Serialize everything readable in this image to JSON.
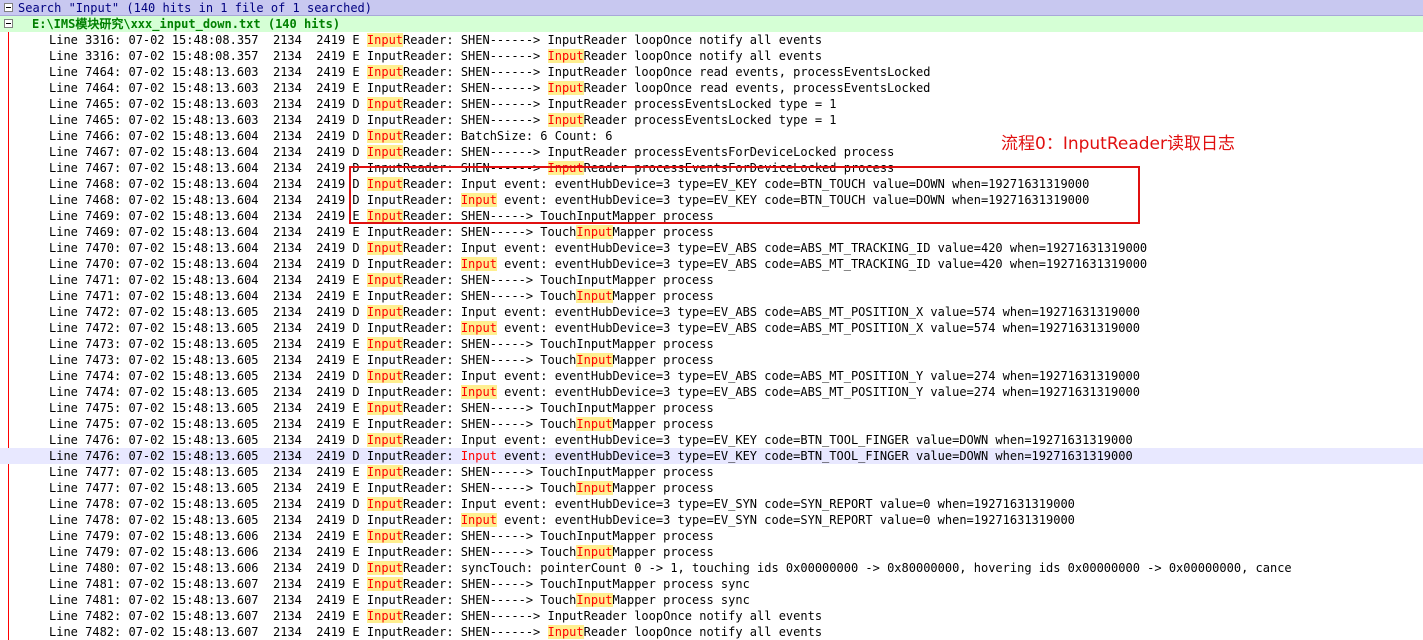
{
  "search": {
    "header": "Search \"Input\" (140 hits in 1 file of 1 searched)",
    "file_header": "E:\\IMS模块研究\\xxx_input_down.txt (140 hits)"
  },
  "annotation": {
    "label": "流程0：InputReader读取日志",
    "color": "#e01010"
  },
  "colors": {
    "search_header_bg": "#c8c8f0",
    "file_header_bg": "#d5ffd5",
    "hit_highlight_bg": "#ffef90",
    "hit_text": "#ff0000",
    "current_line_bg": "#e8e8ff"
  },
  "icons": {
    "collapse": "minus-box-icon"
  },
  "rows": [
    {
      "pre": "Line 3316: 07-02 15:48:08.357  2134  2419 E ",
      "hit": "Input",
      "post": "Reader: SHEN------> InputReader loopOnce notify all events"
    },
    {
      "pre": "Line 3316: 07-02 15:48:08.357  2134  2419 E InputReader: SHEN------> ",
      "hit": "Input",
      "post": "Reader loopOnce notify all events"
    },
    {
      "pre": "Line 7464: 07-02 15:48:13.603  2134  2419 E ",
      "hit": "Input",
      "post": "Reader: SHEN------> InputReader loopOnce read events, processEventsLocked"
    },
    {
      "pre": "Line 7464: 07-02 15:48:13.603  2134  2419 E InputReader: SHEN------> ",
      "hit": "Input",
      "post": "Reader loopOnce read events, processEventsLocked"
    },
    {
      "pre": "Line 7465: 07-02 15:48:13.603  2134  2419 D ",
      "hit": "Input",
      "post": "Reader: SHEN------> InputReader processEventsLocked type = 1"
    },
    {
      "pre": "Line 7465: 07-02 15:48:13.603  2134  2419 D InputReader: SHEN------> ",
      "hit": "Input",
      "post": "Reader processEventsLocked type = 1"
    },
    {
      "pre": "Line 7466: 07-02 15:48:13.604  2134  2419 D ",
      "hit": "Input",
      "post": "Reader: BatchSize: 6 Count: 6"
    },
    {
      "pre": "Line 7467: 07-02 15:48:13.604  2134  2419 D ",
      "hit": "Input",
      "post": "Reader: SHEN------> InputReader processEventsForDeviceLocked process"
    },
    {
      "pre": "Line 7467: 07-02 15:48:13.604  2134  2419 D InputReader: SHEN------> ",
      "hit": "Input",
      "post": "Reader processEventsForDeviceLocked process"
    },
    {
      "pre": "Line 7468: 07-02 15:48:13.604  2134  2419 D ",
      "hit": "Input",
      "post": "Reader: Input event: eventHubDevice=3 type=EV_KEY code=BTN_TOUCH value=DOWN when=19271631319000"
    },
    {
      "pre": "Line 7468: 07-02 15:48:13.604  2134  2419 D InputReader: ",
      "hit": "Input",
      "post": " event: eventHubDevice=3 type=EV_KEY code=BTN_TOUCH value=DOWN when=19271631319000"
    },
    {
      "pre": "Line 7469: 07-02 15:48:13.604  2134  2419 E ",
      "hit": "Input",
      "post": "Reader: SHEN-----> TouchInputMapper process"
    },
    {
      "pre": "Line 7469: 07-02 15:48:13.604  2134  2419 E InputReader: SHEN-----> Touch",
      "hit": "Input",
      "post": "Mapper process"
    },
    {
      "pre": "Line 7470: 07-02 15:48:13.604  2134  2419 D ",
      "hit": "Input",
      "post": "Reader: Input event: eventHubDevice=3 type=EV_ABS code=ABS_MT_TRACKING_ID value=420 when=19271631319000"
    },
    {
      "pre": "Line 7470: 07-02 15:48:13.604  2134  2419 D InputReader: ",
      "hit": "Input",
      "post": " event: eventHubDevice=3 type=EV_ABS code=ABS_MT_TRACKING_ID value=420 when=19271631319000"
    },
    {
      "pre": "Line 7471: 07-02 15:48:13.604  2134  2419 E ",
      "hit": "Input",
      "post": "Reader: SHEN-----> TouchInputMapper process"
    },
    {
      "pre": "Line 7471: 07-02 15:48:13.604  2134  2419 E InputReader: SHEN-----> Touch",
      "hit": "Input",
      "post": "Mapper process"
    },
    {
      "pre": "Line 7472: 07-02 15:48:13.605  2134  2419 D ",
      "hit": "Input",
      "post": "Reader: Input event: eventHubDevice=3 type=EV_ABS code=ABS_MT_POSITION_X value=574 when=19271631319000"
    },
    {
      "pre": "Line 7472: 07-02 15:48:13.605  2134  2419 D InputReader: ",
      "hit": "Input",
      "post": " event: eventHubDevice=3 type=EV_ABS code=ABS_MT_POSITION_X value=574 when=19271631319000"
    },
    {
      "pre": "Line 7473: 07-02 15:48:13.605  2134  2419 E ",
      "hit": "Input",
      "post": "Reader: SHEN-----> TouchInputMapper process"
    },
    {
      "pre": "Line 7473: 07-02 15:48:13.605  2134  2419 E InputReader: SHEN-----> Touch",
      "hit": "Input",
      "post": "Mapper process"
    },
    {
      "pre": "Line 7474: 07-02 15:48:13.605  2134  2419 D ",
      "hit": "Input",
      "post": "Reader: Input event: eventHubDevice=3 type=EV_ABS code=ABS_MT_POSITION_Y value=274 when=19271631319000"
    },
    {
      "pre": "Line 7474: 07-02 15:48:13.605  2134  2419 D InputReader: ",
      "hit": "Input",
      "post": " event: eventHubDevice=3 type=EV_ABS code=ABS_MT_POSITION_Y value=274 when=19271631319000"
    },
    {
      "pre": "Line 7475: 07-02 15:48:13.605  2134  2419 E ",
      "hit": "Input",
      "post": "Reader: SHEN-----> TouchInputMapper process"
    },
    {
      "pre": "Line 7475: 07-02 15:48:13.605  2134  2419 E InputReader: SHEN-----> Touch",
      "hit": "Input",
      "post": "Mapper process"
    },
    {
      "pre": "Line 7476: 07-02 15:48:13.605  2134  2419 D ",
      "hit": "Input",
      "post": "Reader: Input event: eventHubDevice=3 type=EV_KEY code=BTN_TOOL_FINGER value=DOWN when=19271631319000"
    },
    {
      "pre": "Line 7476: 07-02 15:48:13.605  2134  2419 D InputReader: ",
      "hit": "Input",
      "post": " event: eventHubDevice=3 type=EV_KEY code=BTN_TOOL_FINGER value=DOWN when=19271631319000",
      "current": true
    },
    {
      "pre": "Line 7477: 07-02 15:48:13.605  2134  2419 E ",
      "hit": "Input",
      "post": "Reader: SHEN-----> TouchInputMapper process"
    },
    {
      "pre": "Line 7477: 07-02 15:48:13.605  2134  2419 E InputReader: SHEN-----> Touch",
      "hit": "Input",
      "post": "Mapper process"
    },
    {
      "pre": "Line 7478: 07-02 15:48:13.605  2134  2419 D ",
      "hit": "Input",
      "post": "Reader: Input event: eventHubDevice=3 type=EV_SYN code=SYN_REPORT value=0 when=19271631319000"
    },
    {
      "pre": "Line 7478: 07-02 15:48:13.605  2134  2419 D InputReader: ",
      "hit": "Input",
      "post": " event: eventHubDevice=3 type=EV_SYN code=SYN_REPORT value=0 when=19271631319000"
    },
    {
      "pre": "Line 7479: 07-02 15:48:13.606  2134  2419 E ",
      "hit": "Input",
      "post": "Reader: SHEN-----> TouchInputMapper process"
    },
    {
      "pre": "Line 7479: 07-02 15:48:13.606  2134  2419 E InputReader: SHEN-----> Touch",
      "hit": "Input",
      "post": "Mapper process"
    },
    {
      "pre": "Line 7480: 07-02 15:48:13.606  2134  2419 D ",
      "hit": "Input",
      "post": "Reader: syncTouch: pointerCount 0 -> 1, touching ids 0x00000000 -> 0x80000000, hovering ids 0x00000000 -> 0x00000000, cance"
    },
    {
      "pre": "Line 7481: 07-02 15:48:13.607  2134  2419 E ",
      "hit": "Input",
      "post": "Reader: SHEN-----> TouchInputMapper process sync"
    },
    {
      "pre": "Line 7481: 07-02 15:48:13.607  2134  2419 E InputReader: SHEN-----> Touch",
      "hit": "Input",
      "post": "Mapper process sync"
    },
    {
      "pre": "Line 7482: 07-02 15:48:13.607  2134  2419 E ",
      "hit": "Input",
      "post": "Reader: SHEN------> InputReader loopOnce notify all events"
    },
    {
      "pre": "Line 7482: 07-02 15:48:13.607  2134  2419 E InputReader: SHEN------> ",
      "hit": "Input",
      "post": "Reader loopOnce notify all events"
    }
  ]
}
